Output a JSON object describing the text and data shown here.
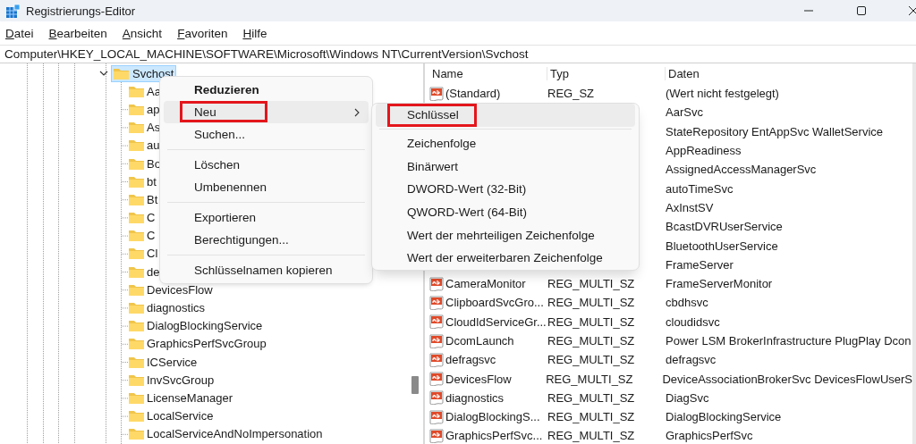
{
  "window": {
    "title": "Registrierungs-Editor"
  },
  "menu_bar": [
    "Datei",
    "Bearbeiten",
    "Ansicht",
    "Favoriten",
    "Hilfe"
  ],
  "address": "Computer\\HKEY_LOCAL_MACHINE\\SOFTWARE\\Microsoft\\Windows NT\\CurrentVersion\\Svchost",
  "tree": {
    "label": "Svchost",
    "selected": true,
    "expanded": true,
    "children": [
      {
        "label": "Aa"
      },
      {
        "label": "ap"
      },
      {
        "label": "As"
      },
      {
        "label": "au"
      },
      {
        "label": "Bo"
      },
      {
        "label": "bt"
      },
      {
        "label": "Bt"
      },
      {
        "label": "C"
      },
      {
        "label": "C"
      },
      {
        "label": "Cl"
      },
      {
        "label": "de"
      },
      {
        "label": "DevicesFlow"
      },
      {
        "label": "diagnostics"
      },
      {
        "label": "DialogBlockingService"
      },
      {
        "label": "GraphicsPerfSvcGroup"
      },
      {
        "label": "ICService"
      },
      {
        "label": "InvSvcGroup"
      },
      {
        "label": "LicenseManager"
      },
      {
        "label": "LocalService"
      },
      {
        "label": "LocalServiceAndNoImpersonation"
      }
    ]
  },
  "values_table": {
    "columns": [
      "Name",
      "Typ",
      "Daten"
    ],
    "rows": [
      {
        "name": "(Standard)",
        "type": "REG_SZ",
        "data": "(Wert nicht festgelegt)"
      },
      {
        "data": "AarSvc"
      },
      {
        "data": "StateRepository EntAppSvc WalletService"
      },
      {
        "data": "AppReadiness"
      },
      {
        "data": "AssignedAccessManagerSvc"
      },
      {
        "data": "autoTimeSvc"
      },
      {
        "data": "AxInstSV"
      },
      {
        "data": "BcastDVRUserService"
      },
      {
        "data": "BluetoothUserService"
      },
      {
        "data": "FrameServer"
      },
      {
        "name": "CameraMonitor",
        "type": "REG_MULTI_SZ",
        "data": "FrameServerMonitor"
      },
      {
        "name": "ClipboardSvcGro...",
        "type": "REG_MULTI_SZ",
        "data": "cbdhsvc"
      },
      {
        "name": "CloudIdServiceGr...",
        "type": "REG_MULTI_SZ",
        "data": "cloudidsvc"
      },
      {
        "name": "DcomLaunch",
        "type": "REG_MULTI_SZ",
        "data": "Power LSM BrokerInfrastructure PlugPlay Dcon"
      },
      {
        "name": "defragsvc",
        "type": "REG_MULTI_SZ",
        "data": "defragsvc"
      },
      {
        "name": "DevicesFlow",
        "type": "REG_MULTI_SZ",
        "data": "DeviceAssociationBrokerSvc DevicesFlowUserS"
      },
      {
        "name": "diagnostics",
        "type": "REG_MULTI_SZ",
        "data": "DiagSvc"
      },
      {
        "name": "DialogBlockingS...",
        "type": "REG_MULTI_SZ",
        "data": "DialogBlockingService"
      },
      {
        "name": "GraphicsPerfSvc...",
        "type": "REG_MULTI_SZ",
        "data": "GraphicsPerfSvc"
      }
    ]
  },
  "context_menu": [
    {
      "kind": "item",
      "label": "Reduzieren",
      "default": true,
      "selected": false,
      "marked": false,
      "submenu": false
    },
    {
      "kind": "item",
      "label": "Neu",
      "default": false,
      "selected": true,
      "marked": true,
      "submenu": true
    },
    {
      "kind": "item",
      "label": "Suchen...",
      "default": false,
      "selected": false,
      "marked": false,
      "submenu": false
    },
    {
      "kind": "separator"
    },
    {
      "kind": "item",
      "label": "Löschen",
      "default": false,
      "selected": false,
      "marked": false,
      "submenu": false
    },
    {
      "kind": "item",
      "label": "Umbenennen",
      "default": false,
      "selected": false,
      "marked": false,
      "submenu": false
    },
    {
      "kind": "separator"
    },
    {
      "kind": "item",
      "label": "Exportieren",
      "default": false,
      "selected": false,
      "marked": false,
      "submenu": false
    },
    {
      "kind": "item",
      "label": "Berechtigungen...",
      "default": false,
      "selected": false,
      "marked": false,
      "submenu": false
    },
    {
      "kind": "separator"
    },
    {
      "kind": "item",
      "label": "Schlüsselnamen kopieren",
      "default": false,
      "selected": false,
      "marked": false,
      "submenu": false
    }
  ],
  "submenu": [
    {
      "kind": "item",
      "label": "Schlüssel",
      "selected": true,
      "marked": true
    },
    {
      "kind": "separator"
    },
    {
      "kind": "item",
      "label": "Zeichenfolge",
      "selected": false,
      "marked": false
    },
    {
      "kind": "item",
      "label": "Binärwert",
      "selected": false,
      "marked": false
    },
    {
      "kind": "item",
      "label": "DWORD-Wert (32-Bit)",
      "selected": false,
      "marked": false
    },
    {
      "kind": "item",
      "label": "QWORD-Wert (64-Bit)",
      "selected": false,
      "marked": false
    },
    {
      "kind": "item",
      "label": "Wert der mehrteiligen Zeichenfolge",
      "selected": false,
      "marked": false
    },
    {
      "kind": "item",
      "label": "Wert der erweiterbaren Zeichenfolge",
      "selected": false,
      "marked": false
    }
  ]
}
